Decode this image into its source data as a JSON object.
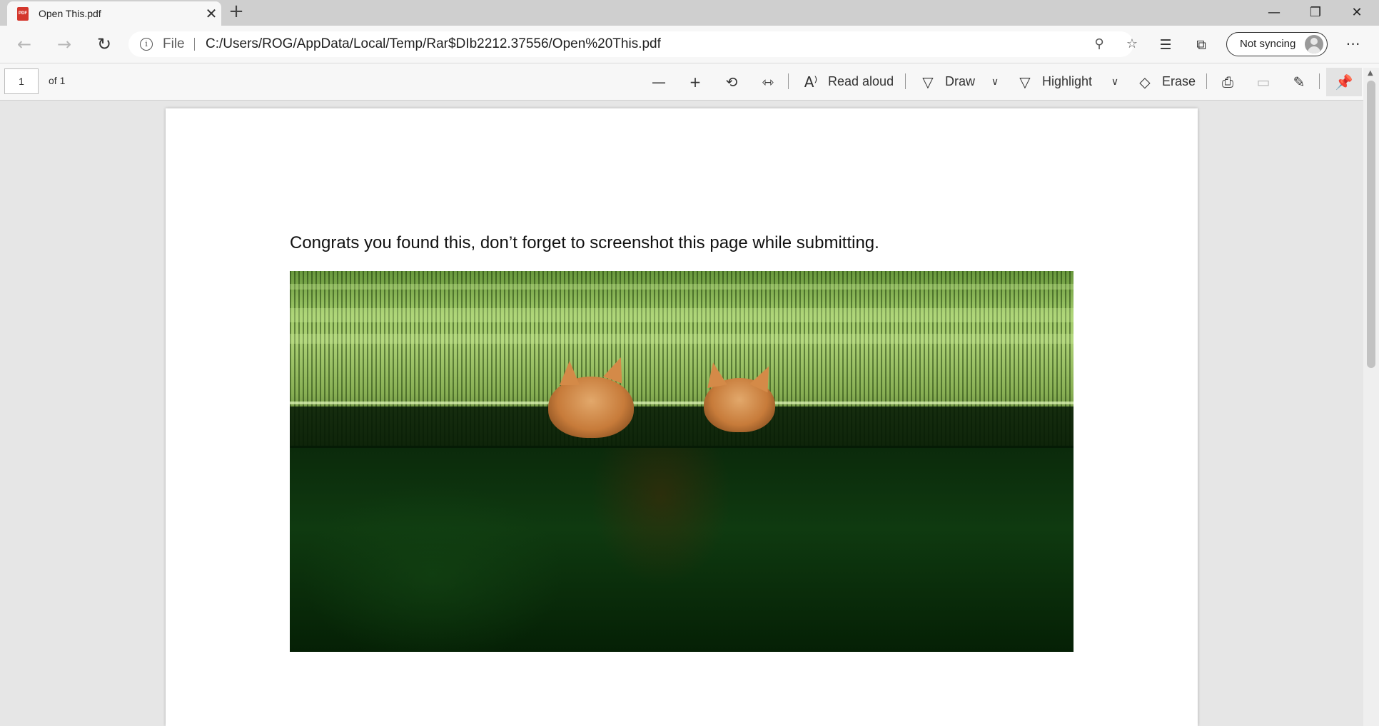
{
  "browser": {
    "tab": {
      "title": "Open This.pdf",
      "icon": "pdf-file-icon",
      "icon_text": "PDF"
    },
    "new_tab_icon": "plus-icon",
    "window_controls": [
      "minimize-icon",
      "restore-icon",
      "close-icon"
    ]
  },
  "addressbar": {
    "scheme_label": "File",
    "url": "C:/Users/ROG/AppData/Local/Temp/Rar$DIb2212.37556/Open%20This.pdf",
    "sync_label": "Not syncing"
  },
  "pdf_toolbar": {
    "page_number": "1",
    "page_count_label": "of 1",
    "read_aloud_label": "Read aloud",
    "draw_label": "Draw",
    "highlight_label": "Highlight",
    "erase_label": "Erase"
  },
  "document": {
    "text": "Congrats you found this, don’t forget to screenshot this page while submitting.",
    "image_description_icon": "image-icon"
  },
  "colors": {
    "titlebar": "#cfcfcf",
    "toolbar": "#f7f7f7",
    "page_bg": "#e6e6e6",
    "pdf_icon_red": "#d4372c"
  }
}
